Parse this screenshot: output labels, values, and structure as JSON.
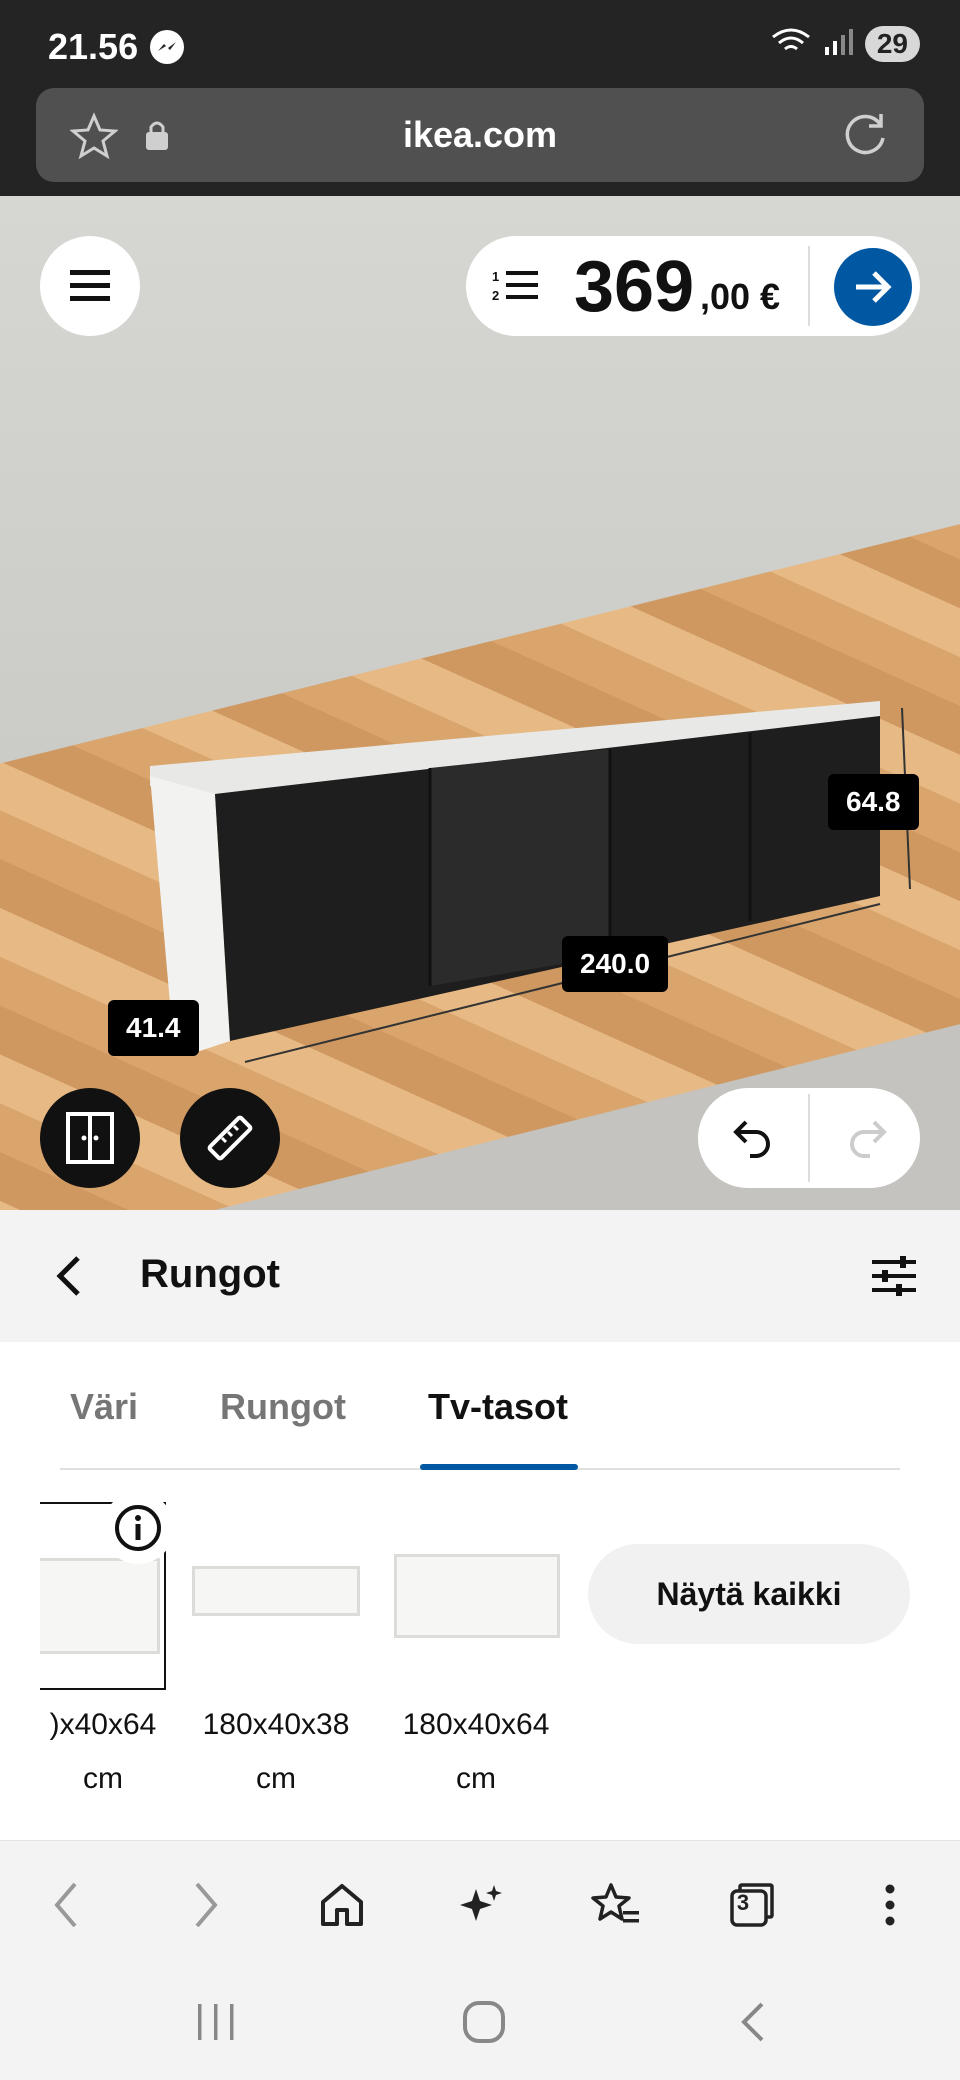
{
  "status": {
    "time": "21.56",
    "battery": "29"
  },
  "browser": {
    "url": "ikea.com",
    "tab_count": "3"
  },
  "header": {
    "price_main": "369",
    "price_decimals": ",00 €"
  },
  "dimensions": {
    "depth": "41.4",
    "width": "240.0",
    "height": "64.8"
  },
  "panel": {
    "title": "Rungot",
    "tabs": [
      {
        "label": "Väri",
        "active": false
      },
      {
        "label": "Rungot",
        "active": false
      },
      {
        "label": "Tv-tasot",
        "active": true
      }
    ],
    "products": [
      {
        "label_line1": ")x40x64",
        "label_line2": "cm",
        "selected": true
      },
      {
        "label_line1": "180x40x38",
        "label_line2": "cm",
        "selected": false
      },
      {
        "label_line1": "180x40x64",
        "label_line2": "cm",
        "selected": false
      }
    ],
    "show_all": "Näytä kaikki"
  },
  "colors": {
    "brand_blue": "#0058a3",
    "dark": "#111111"
  }
}
